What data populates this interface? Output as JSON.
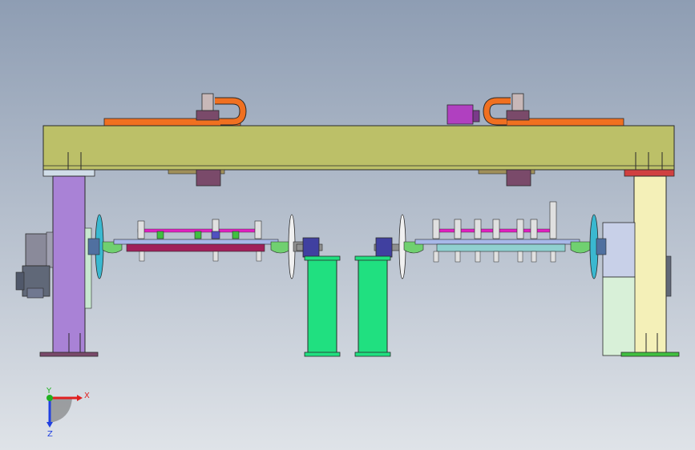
{
  "viewport": {
    "background_top": "#8e9db3",
    "background_bottom": "#dfe3e8"
  },
  "colors": {
    "beam": "#bcc068",
    "hose": "#f07020",
    "left_column": "#a982d6",
    "right_column": "#f4f0b8",
    "pedestal": "#20e080",
    "mount": "#7a4a6a",
    "purple_part": "#b040c0",
    "disk": "#3ab8d0",
    "fixture_rail": "#a8b8e8",
    "fixture_bar_left": "#a0205a",
    "clamp_magenta": "#e020c0",
    "clamp_green": "#40c040",
    "flange": "#70d070",
    "plate_red": "#d04040",
    "plate_green": "#40c040",
    "light_green_box": "#d8f0d8",
    "motor": "#606878",
    "outline": "#2a2a2a"
  },
  "triad": {
    "x_label": "X",
    "y_label": "Y",
    "z_label": "Z",
    "x_color": "#e02020",
    "y_color": "#20b020",
    "z_color": "#2040e0"
  }
}
